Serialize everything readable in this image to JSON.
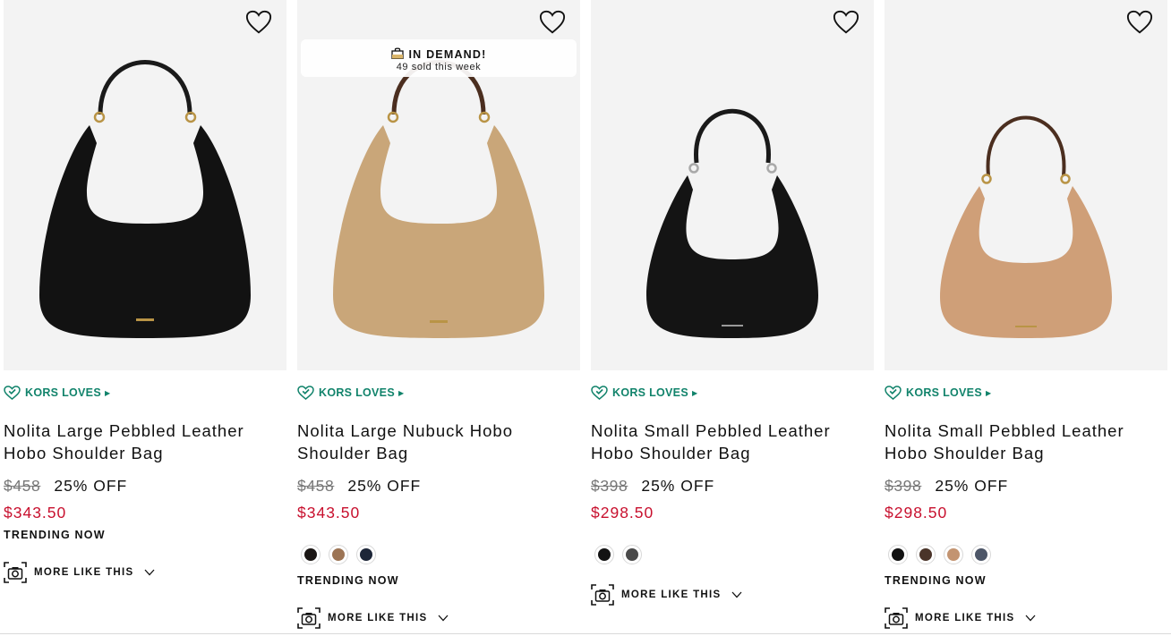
{
  "products": [
    {
      "badge": "KORS LOVES",
      "title": "Nolita Large Pebbled Leather Hobo Shoulder Bag",
      "original_price": "$458",
      "discount": "25% OFF",
      "sale_price": "$343.50",
      "trending": "TRENDING NOW",
      "more_like_this": "MORE LIKE THIS",
      "bag_color": "#121212",
      "swatches": []
    },
    {
      "badge": "KORS LOVES",
      "title": "Nolita Large Nubuck Hobo Shoulder Bag",
      "original_price": "$458",
      "discount": "25% OFF",
      "sale_price": "$343.50",
      "trending": "TRENDING NOW",
      "more_like_this": "MORE LIKE THIS",
      "demand_title": "IN DEMAND!",
      "demand_sub": "49 sold this week",
      "bag_color": "#c9a679",
      "swatches": [
        "#1a1614",
        "#9c7454",
        "#1d2638"
      ]
    },
    {
      "badge": "KORS LOVES",
      "title": "Nolita Small Pebbled Leather Hobo Shoulder Bag",
      "original_price": "$398",
      "discount": "25% OFF",
      "sale_price": "$298.50",
      "more_like_this": "MORE LIKE THIS",
      "bag_color": "#141414",
      "swatches": [
        "#131313",
        "#4a4a4a"
      ]
    },
    {
      "badge": "KORS LOVES",
      "title": "Nolita Small Pebbled Leather Hobo Shoulder Bag",
      "original_price": "$398",
      "discount": "25% OFF",
      "sale_price": "$298.50",
      "trending": "TRENDING NOW",
      "more_like_this": "MORE LIKE THIS",
      "bag_color": "#cf9f78",
      "swatches": [
        "#121212",
        "#4a3429",
        "#c39471",
        "#4d5668"
      ]
    }
  ],
  "icons": {
    "wishlist": "heart-outline-icon",
    "badge": "heart-check-icon",
    "visual_search": "camera-icon",
    "expand": "chevron-down-icon",
    "demand": "shopping-bag-icon"
  },
  "colors": {
    "kors_loves": "#11836b",
    "sale_price": "#c8102e",
    "strike_price": "#777777",
    "image_bg": "#f3f3f3"
  }
}
